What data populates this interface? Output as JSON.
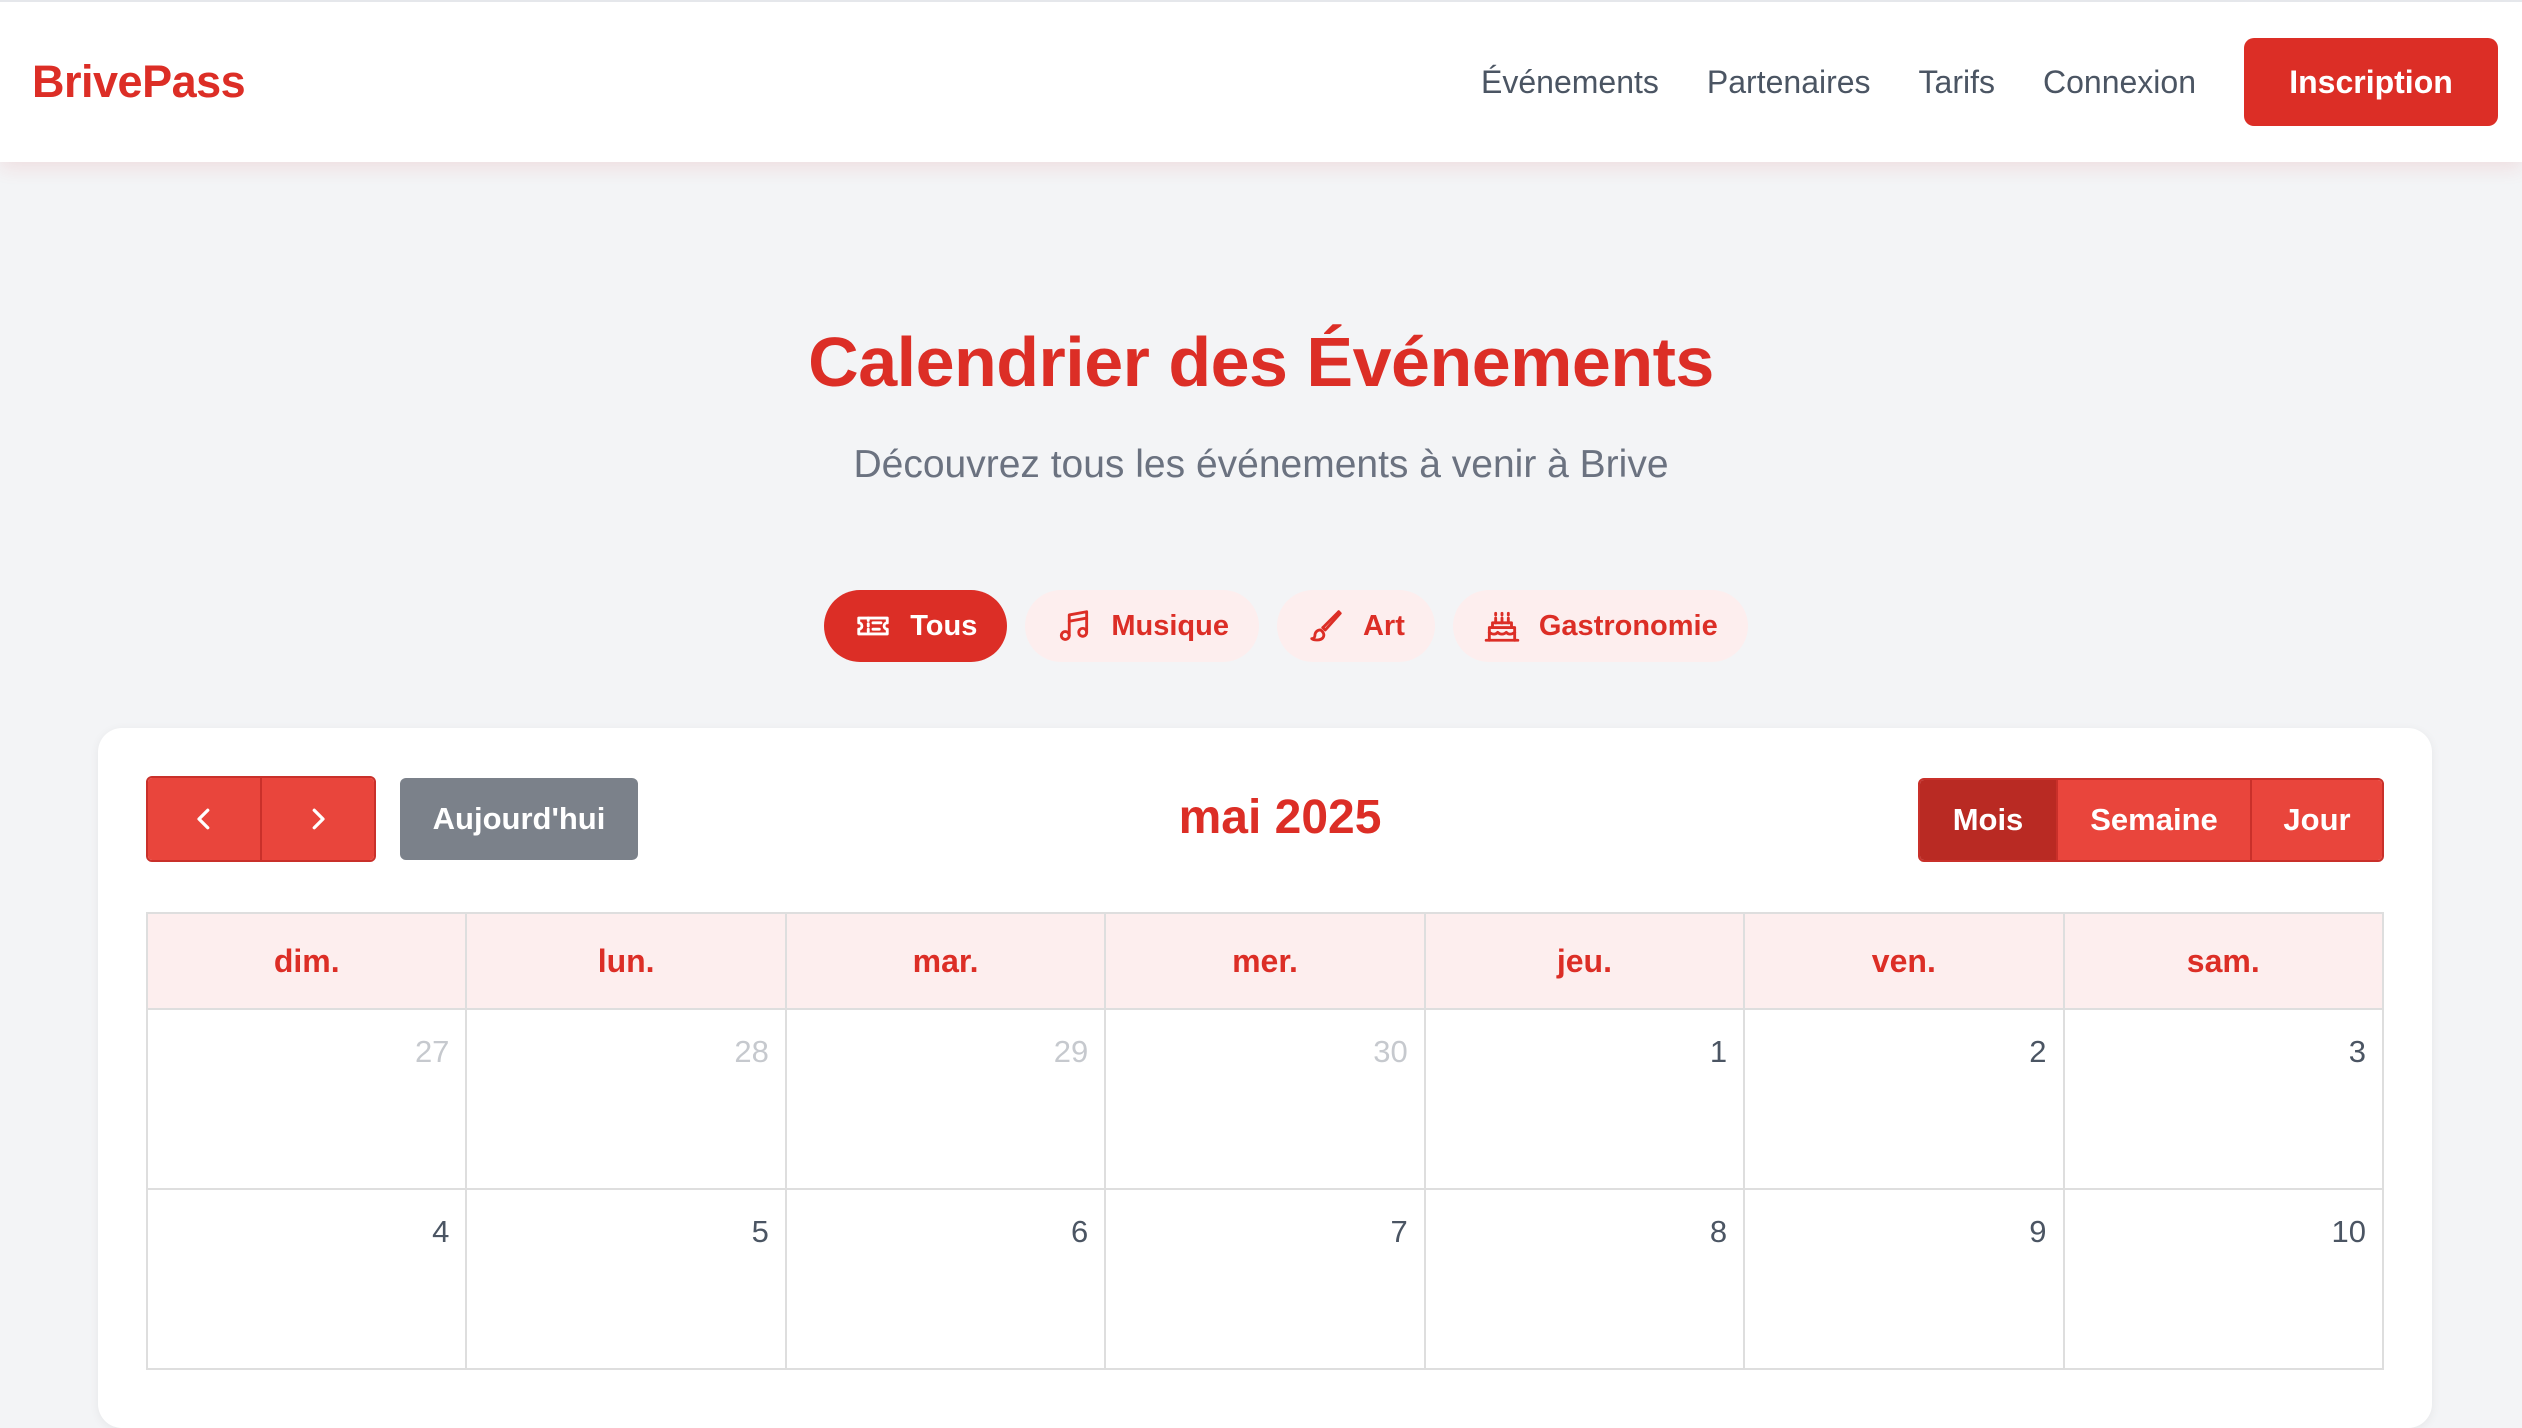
{
  "header": {
    "logo": "BrivePass",
    "nav": [
      "Événements",
      "Partenaires",
      "Tarifs",
      "Connexion"
    ],
    "cta": "Inscription"
  },
  "hero": {
    "title": "Calendrier des Événements",
    "subtitle": "Découvrez tous les événements à venir à Brive"
  },
  "filters": [
    {
      "label": "Tous",
      "icon": "ticket-icon",
      "active": true
    },
    {
      "label": "Musique",
      "icon": "music-icon",
      "active": false
    },
    {
      "label": "Art",
      "icon": "paintbrush-icon",
      "active": false
    },
    {
      "label": "Gastronomie",
      "icon": "cake-icon",
      "active": false
    }
  ],
  "calendar": {
    "prev_icon": "chevron-left-icon",
    "next_icon": "chevron-right-icon",
    "today_label": "Aujourd'hui",
    "title": "mai 2025",
    "views": [
      {
        "label": "Mois",
        "active": true
      },
      {
        "label": "Semaine",
        "active": false
      },
      {
        "label": "Jour",
        "active": false
      }
    ],
    "weekdays": [
      "dim.",
      "lun.",
      "mar.",
      "mer.",
      "jeu.",
      "ven.",
      "sam."
    ],
    "weeks": [
      [
        {
          "day": "27",
          "other": true
        },
        {
          "day": "28",
          "other": true
        },
        {
          "day": "29",
          "other": true
        },
        {
          "day": "30",
          "other": true
        },
        {
          "day": "1",
          "other": false
        },
        {
          "day": "2",
          "other": false
        },
        {
          "day": "3",
          "other": false
        }
      ],
      [
        {
          "day": "4",
          "other": false
        },
        {
          "day": "5",
          "other": false
        },
        {
          "day": "6",
          "other": false
        },
        {
          "day": "7",
          "other": false
        },
        {
          "day": "8",
          "other": false
        },
        {
          "day": "9",
          "other": false
        },
        {
          "day": "10",
          "other": false
        }
      ]
    ]
  },
  "colors": {
    "brand": "#dc2e26",
    "chip_bg": "#fdeeee",
    "today_button": "#7b818a",
    "active_view": "#b92a23"
  }
}
